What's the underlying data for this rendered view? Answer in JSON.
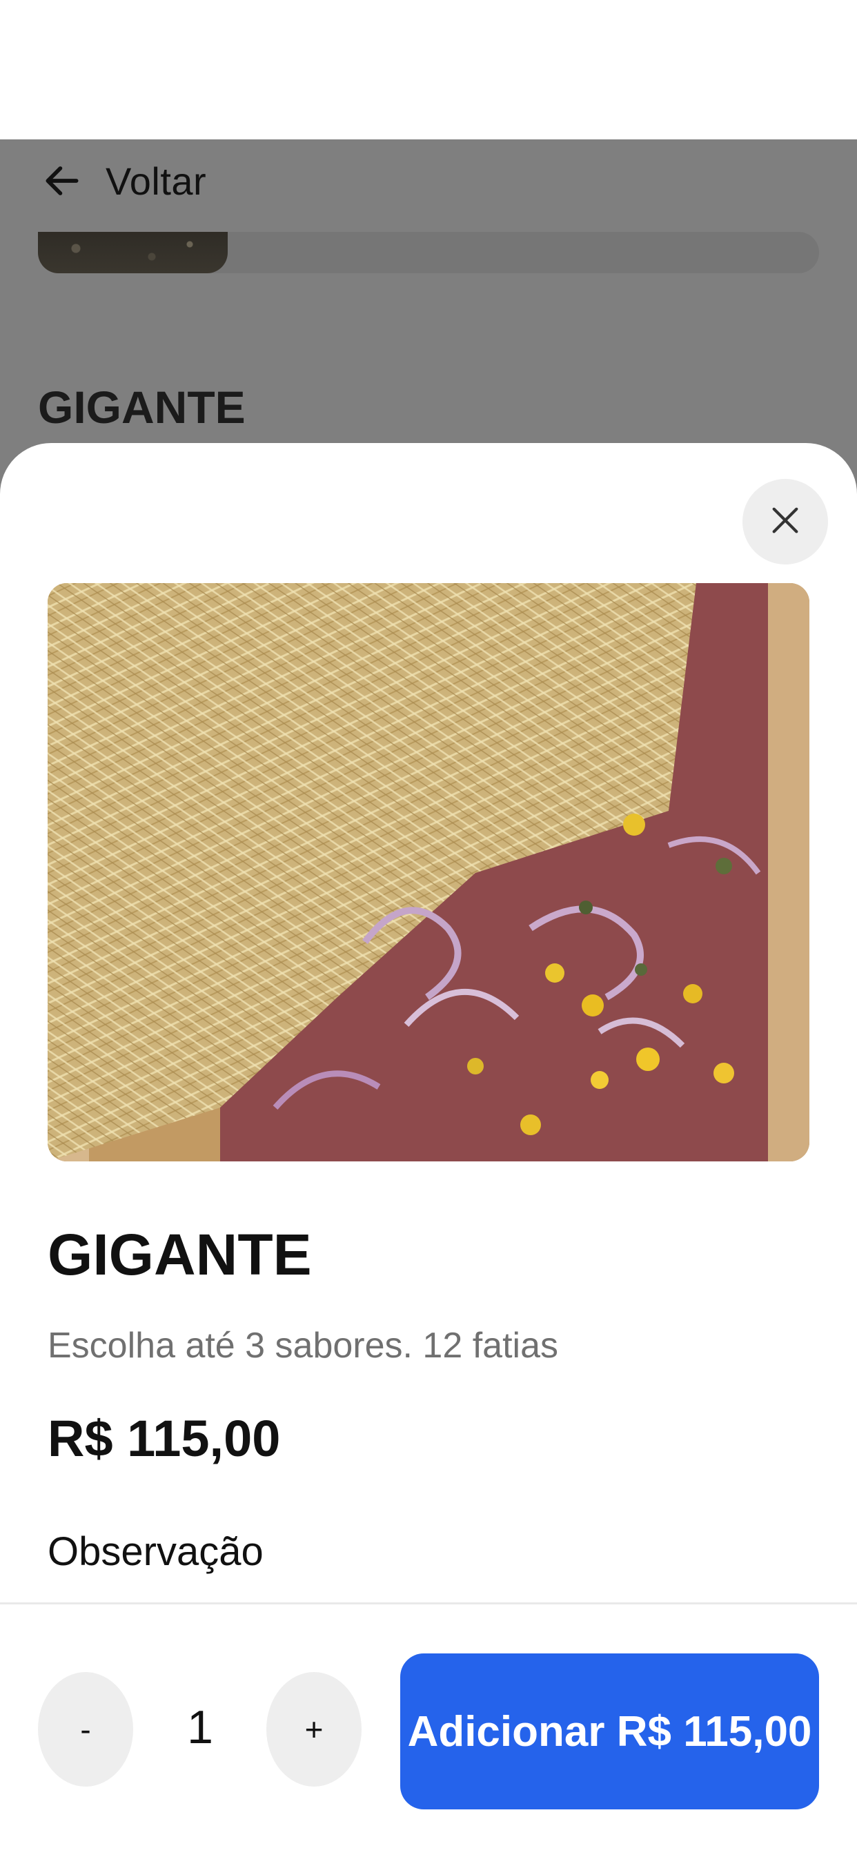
{
  "header": {
    "back_label": "Voltar",
    "background_title": "GIGANTE"
  },
  "modal": {
    "close_icon": "close-icon",
    "image_alt": "Pizza gigante com batata palha, calabresa, cebola roxa e milho",
    "title": "GIGANTE",
    "description": "Escolha até 3 sabores. 12 fatias",
    "price": "R$ 115,00",
    "observation_label": "Observação"
  },
  "footer": {
    "minus_label": "-",
    "quantity": "1",
    "plus_label": "+",
    "add_button_label": "Adicionar R$ 115,00"
  },
  "colors": {
    "accent": "#2563eb",
    "backdrop": "#7f7f7f",
    "button_bg": "#eeeeee"
  }
}
